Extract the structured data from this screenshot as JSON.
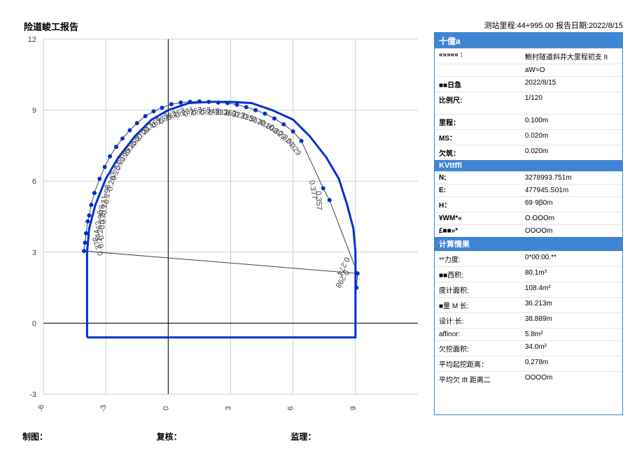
{
  "title": "险道峻工报告",
  "meta": {
    "station_label": "测站里程:",
    "station": "44+995.00",
    "date_label": "报告日期:",
    "date": "2022/8/15"
  },
  "side": {
    "header": "十億a",
    "basic": [
      {
        "k": "«»»«« :",
        "v": "鮑村隧道斜井大里程初支 II"
      },
      {
        "k": "",
        "v": "aW=O"
      },
      {
        "k": "■■日急",
        "v": "2022/8/15"
      },
      {
        "k": "比例尺:",
        "v": "1/120"
      }
    ],
    "section2": [
      {
        "k": "里程：",
        "v": "0.100m"
      },
      {
        "k": "MS：",
        "v": "0.020m"
      },
      {
        "k": "欠筑：",
        "v": "0.020m"
      }
    ],
    "kvh_header": "KVttffl",
    "kvh": [
      {
        "k": "N;",
        "v": "3278993.751m"
      },
      {
        "k": "E:",
        "v": "477945.S01m"
      },
      {
        "k": "H：",
        "v": "69·9β0m"
      },
      {
        "k": "¥WM*«",
        "v": "O.OOOm"
      },
      {
        "k": "£■■»*",
        "v": "OOOOm"
      }
    ],
    "calc_header": "计算情果",
    "calc": [
      {
        "k": "**力度:",
        "v": "0*00:00.**"
      },
      {
        "k": "■■西积:",
        "v": "80.1m³"
      },
      {
        "k": "度计面积:",
        "v": "108.4m²"
      },
      {
        "k": "■量 M 长:",
        "v": "36.213m"
      },
      {
        "k": "设计:长:",
        "v": "38.889m"
      },
      {
        "k": "affinor:",
        "v": "5.8m²"
      },
      {
        "k": "欠挖面积:",
        "v": "34.0m²"
      },
      {
        "k": "平均起挖距离：",
        "v": "0.278m"
      },
      {
        "k": "平均欠 Ift 距离二",
        "v": "OOOOm"
      }
    ]
  },
  "footer": {
    "draw": "制图：",
    "review": "复核：",
    "supervise": "监理："
  },
  "chart_data": {
    "type": "scatter",
    "xlim": [
      -6,
      12
    ],
    "ylim": [
      -3,
      12
    ],
    "xticks": [
      -6,
      -3,
      0,
      3,
      6,
      9
    ],
    "yticks": [
      -3,
      0,
      3,
      6,
      9,
      12
    ],
    "tunnel_outline": [
      [
        -3.9,
        -0.6
      ],
      [
        -3.9,
        3.0
      ],
      [
        -3.8,
        4.0
      ],
      [
        -3.5,
        5.0
      ],
      [
        -3.0,
        6.1
      ],
      [
        -2.4,
        7.0
      ],
      [
        -1.6,
        7.9
      ],
      [
        -0.8,
        8.6
      ],
      [
        0.0,
        9.0
      ],
      [
        1.0,
        9.3
      ],
      [
        2.0,
        9.35
      ],
      [
        3.0,
        9.35
      ],
      [
        4.0,
        9.3
      ],
      [
        5.0,
        9.0
      ],
      [
        6.0,
        8.6
      ],
      [
        6.8,
        7.9
      ],
      [
        7.6,
        7.0
      ],
      [
        8.2,
        6.1
      ],
      [
        8.6,
        5.0
      ],
      [
        8.9,
        4.0
      ],
      [
        9.0,
        3.0
      ],
      [
        9.0,
        -0.6
      ],
      [
        -3.9,
        -0.6
      ]
    ],
    "measured_points": [
      {
        "x": -4.05,
        "y": 3.05,
        "d": 0.378
      },
      {
        "x": -4.0,
        "y": 3.4,
        "d": 0.244
      },
      {
        "x": -3.95,
        "y": 3.8,
        "d": 0.262
      },
      {
        "x": -3.87,
        "y": 4.3,
        "d": 0.296
      },
      {
        "x": -3.8,
        "y": 4.55,
        "d": 0.278
      },
      {
        "x": -3.7,
        "y": 5.0,
        "d": 0.271
      },
      {
        "x": -3.55,
        "y": 5.5,
        "d": 0.298
      },
      {
        "x": -3.3,
        "y": 6.1,
        "d": 0.263
      },
      {
        "x": -3.05,
        "y": 6.6,
        "d": 0.254
      },
      {
        "x": -2.8,
        "y": 7.05,
        "d": 0.276
      },
      {
        "x": -2.5,
        "y": 7.45,
        "d": 0.291
      },
      {
        "x": -2.2,
        "y": 7.8,
        "d": 0.258
      },
      {
        "x": -1.85,
        "y": 8.15,
        "d": 0.27
      },
      {
        "x": -1.5,
        "y": 8.45,
        "d": 0.247
      },
      {
        "x": -1.1,
        "y": 8.75,
        "d": 0.169
      },
      {
        "x": -0.7,
        "y": 8.95,
        "d": 0.232
      },
      {
        "x": -0.3,
        "y": 9.1,
        "d": 0.282
      },
      {
        "x": 0.15,
        "y": 9.25,
        "d": 0.252
      },
      {
        "x": 0.6,
        "y": 9.32,
        "d": 0.231
      },
      {
        "x": 1.05,
        "y": 9.35,
        "d": 0.253
      },
      {
        "x": 1.5,
        "y": 9.37,
        "d": 0.253
      },
      {
        "x": 1.95,
        "y": 9.35,
        "d": 0.248
      },
      {
        "x": 2.4,
        "y": 9.32,
        "d": 0.233
      },
      {
        "x": 2.85,
        "y": 9.3,
        "d": 0.26
      },
      {
        "x": 3.3,
        "y": 9.23,
        "d": 0.327
      },
      {
        "x": 3.75,
        "y": 9.13,
        "d": 0.335
      },
      {
        "x": 4.2,
        "y": 9.0,
        "d": 0.307
      },
      {
        "x": 4.65,
        "y": 8.85,
        "d": 0.301
      },
      {
        "x": 5.1,
        "y": 8.65,
        "d": 0.308
      },
      {
        "x": 5.55,
        "y": 8.4,
        "d": 0.329
      },
      {
        "x": 6.0,
        "y": 8.1,
        "d": 0.324
      },
      {
        "x": 6.4,
        "y": 7.7,
        "d": 0.329
      },
      {
        "x": 7.45,
        "y": 5.7,
        "d": 0.377
      },
      {
        "x": 7.75,
        "y": 5.2,
        "d": 0.357
      },
      {
        "x": 9.1,
        "y": 2.1,
        "d": 0.274
      },
      {
        "x": 9.05,
        "y": 1.5,
        "d": 0.298
      }
    ],
    "inner_line": [
      [
        -4.05,
        3.05
      ],
      [
        9.1,
        2.1
      ]
    ]
  }
}
